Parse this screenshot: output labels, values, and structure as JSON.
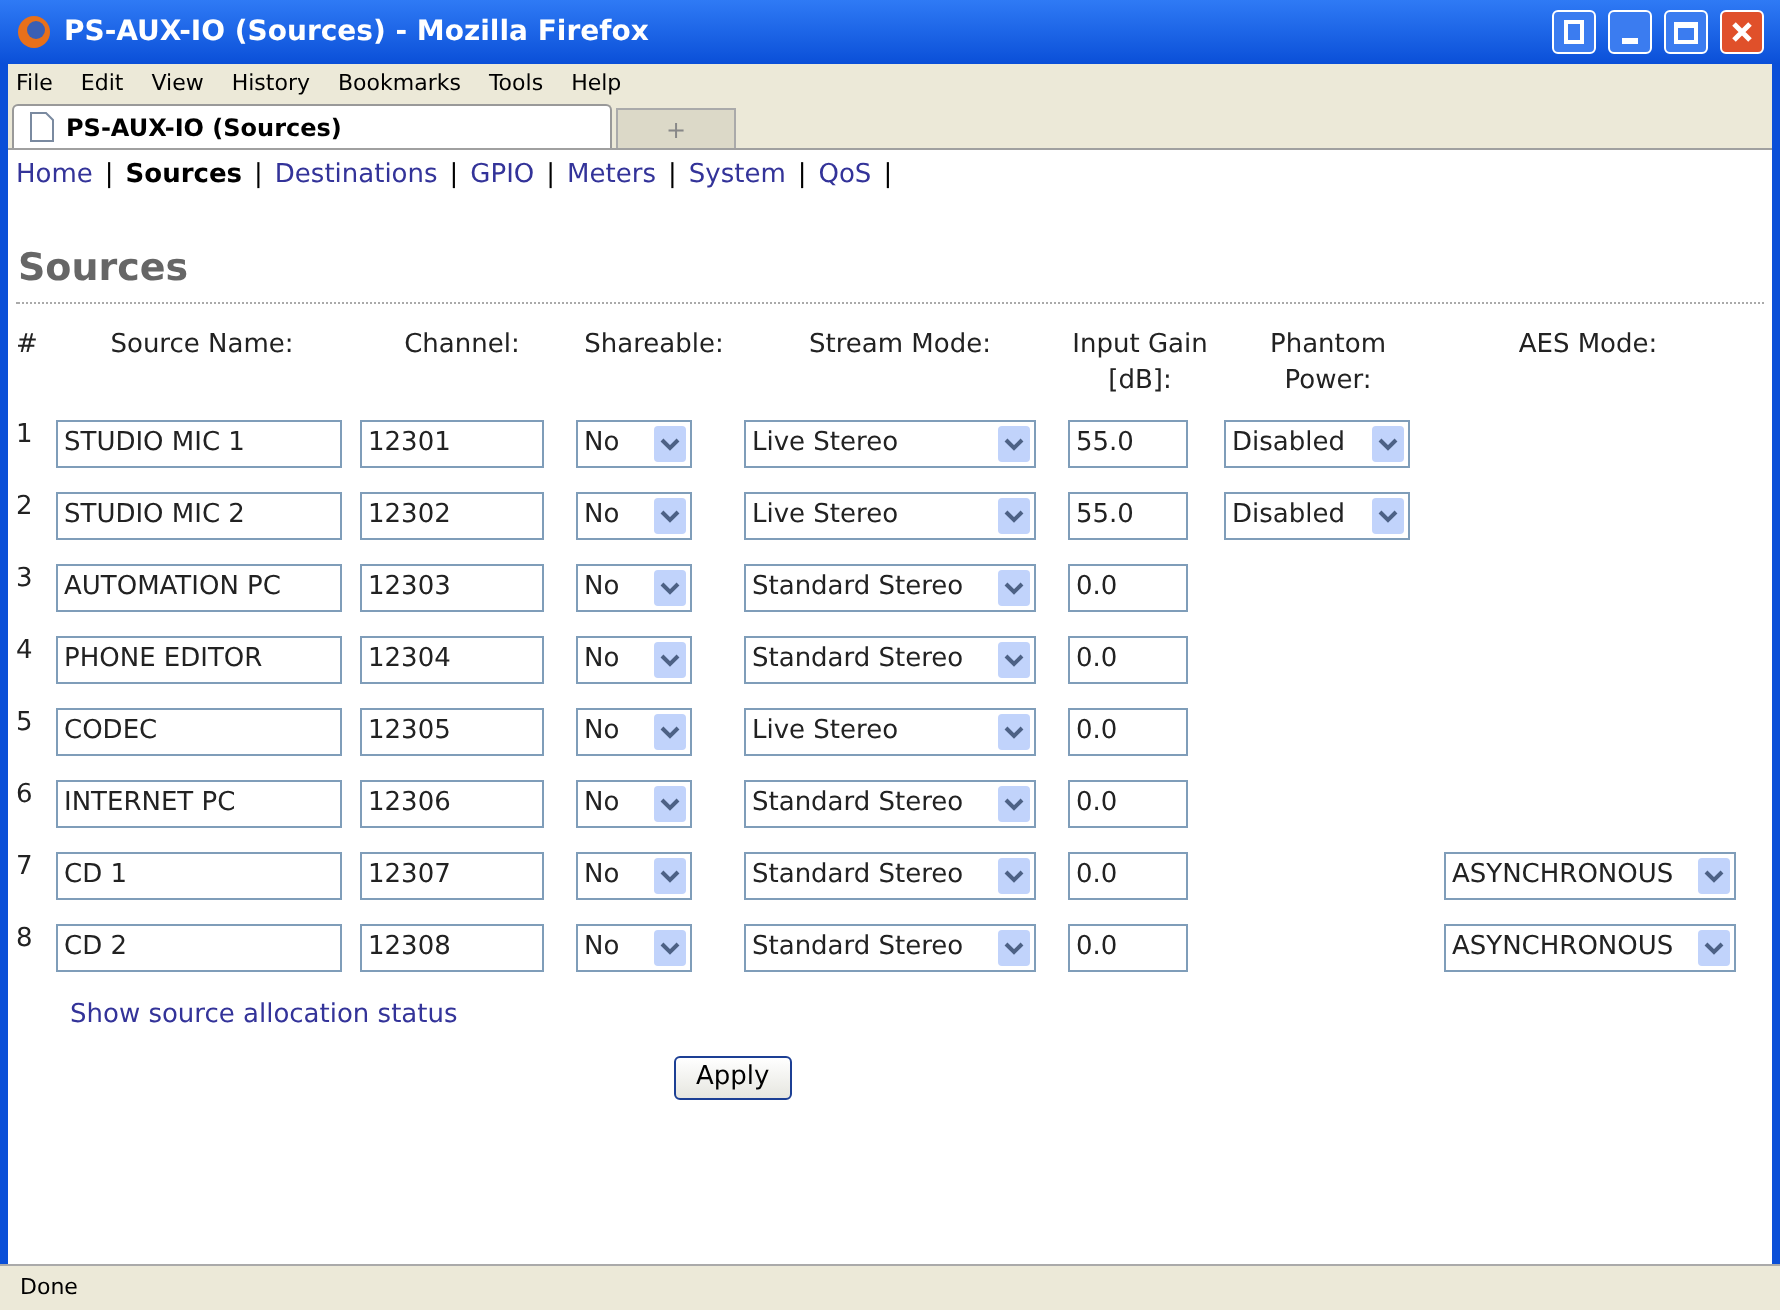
{
  "window": {
    "title": "PS-AUX-IO (Sources) - Mozilla Firefox"
  },
  "menu": [
    "File",
    "Edit",
    "View",
    "History",
    "Bookmarks",
    "Tools",
    "Help"
  ],
  "tabs": [
    {
      "label": "PS-AUX-IO (Sources)",
      "selected": true
    },
    {
      "label": "+",
      "selected": false
    }
  ],
  "nav": [
    {
      "label": "Home",
      "selected": false,
      "separator": "|"
    },
    {
      "label": "Sources",
      "selected": true,
      "separator": "|"
    },
    {
      "label": "Destinations",
      "selected": false,
      "separator": "|"
    },
    {
      "label": "GPIO",
      "selected": false,
      "separator": "|"
    },
    {
      "label": "Meters",
      "selected": false,
      "separator": "|"
    },
    {
      "label": "System",
      "selected": false,
      "separator": "|"
    },
    {
      "label": "QoS",
      "selected": false,
      "separator": "|"
    }
  ],
  "heading": "Sources",
  "columns": [
    "#",
    "Source Name:",
    "Channel:",
    "Shareable:",
    "Stream Mode:",
    "Input Gain [dB]:",
    "Phantom Power:",
    "AES Mode:"
  ],
  "rows": [
    {
      "number": "1",
      "name": "STUDIO MIC 1",
      "channel": "12301",
      "shareable": "No",
      "stream_mode": "Live Stereo",
      "gain": "55.0",
      "phantom": "Disabled"
    },
    {
      "number": "2",
      "name": "STUDIO MIC 2",
      "channel": "12302",
      "shareable": "No",
      "stream_mode": "Live Stereo",
      "gain": "55.0",
      "phantom": "Disabled"
    },
    {
      "number": "3",
      "name": "AUTOMATION PC",
      "channel": "12303",
      "shareable": "No",
      "stream_mode": "Standard Stereo",
      "gain": "0.0"
    },
    {
      "number": "4",
      "name": "PHONE EDITOR",
      "channel": "12304",
      "shareable": "No",
      "stream_mode": "Standard Stereo",
      "gain": "0.0"
    },
    {
      "number": "5",
      "name": "CODEC",
      "channel": "12305",
      "shareable": "No",
      "stream_mode": "Live Stereo",
      "gain": "0.0"
    },
    {
      "number": "6",
      "name": "INTERNET PC",
      "channel": "12306",
      "shareable": "No",
      "stream_mode": "Standard Stereo",
      "gain": "0.0"
    },
    {
      "number": "7",
      "name": "CD 1",
      "channel": "12307",
      "shareable": "No",
      "stream_mode": "Standard Stereo",
      "gain": "0.0",
      "aes_mode": "ASYNCHRONOUS"
    },
    {
      "number": "8",
      "name": "CD 2",
      "channel": "12308",
      "shareable": "No",
      "stream_mode": "Standard Stereo",
      "gain": "0.0",
      "aes_mode": "ASYNCHRONOUS"
    }
  ],
  "link": "Show source allocation status",
  "apply_button": "Apply",
  "status_bar": "Done"
}
